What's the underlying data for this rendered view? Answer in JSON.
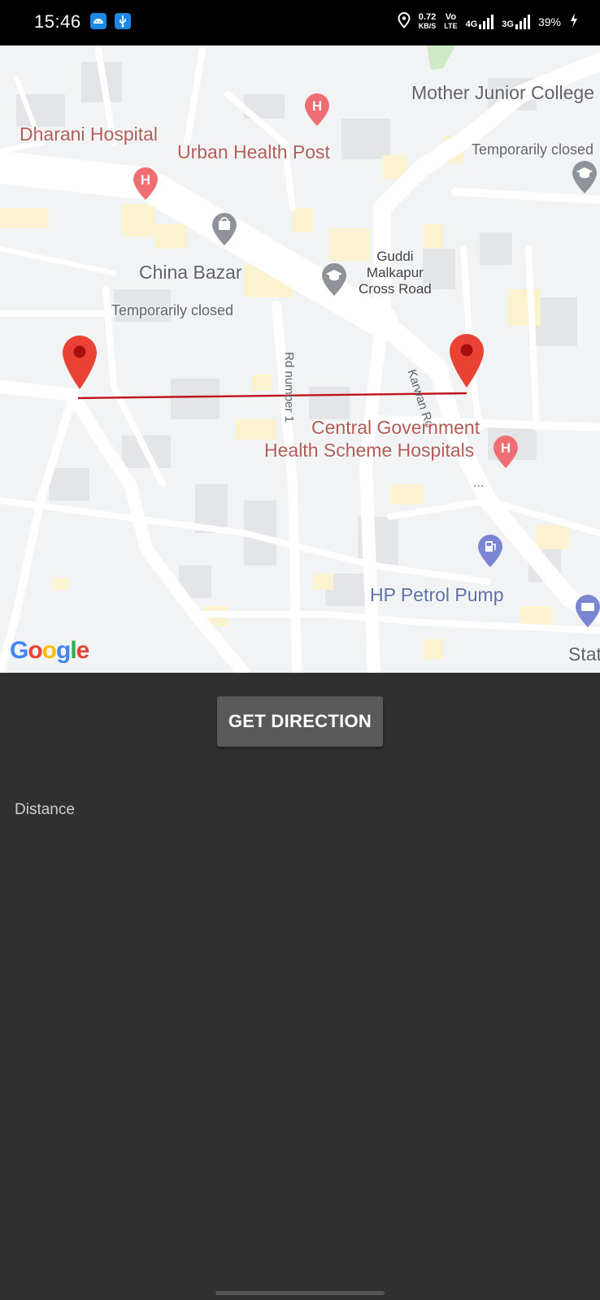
{
  "status_bar": {
    "time": "15:46",
    "speed_value": "0.72",
    "speed_unit": "KB/S",
    "volte_top": "Vo",
    "volte_bottom": "LTE",
    "net1": "4G",
    "net2": "3G",
    "battery": "39%",
    "icons": [
      "android-icon",
      "usb-icon",
      "location-icon",
      "signal-icon",
      "battery-charging-icon"
    ]
  },
  "map": {
    "labels": {
      "mother_junior_college": "Mother Junior College",
      "temp_closed_1": "Temporarily closed",
      "dharani_hospital": "Dharani Hospital",
      "urban_health_post": "Urban Health Post",
      "china_bazar": "China Bazar",
      "temp_closed_2": "Temporarily closed",
      "guddi_1": "Guddi",
      "guddi_2": "Malkapur",
      "guddi_3": "Cross Road",
      "rd_number_1": "Rd number 1",
      "karwan_rd": "Karwan Rd",
      "cghs_1": "Central Government",
      "cghs_2": "Health Scheme Hospitals",
      "ellipsis": "...",
      "hp_petrol_pump": "HP Petrol Pump",
      "stat": "Stat"
    },
    "logo": "Google",
    "route_color": "#c0111a",
    "marker_color": "#ea4335"
  },
  "panel": {
    "button_label": "GET DIRECTION",
    "distance_label": "Distance"
  }
}
